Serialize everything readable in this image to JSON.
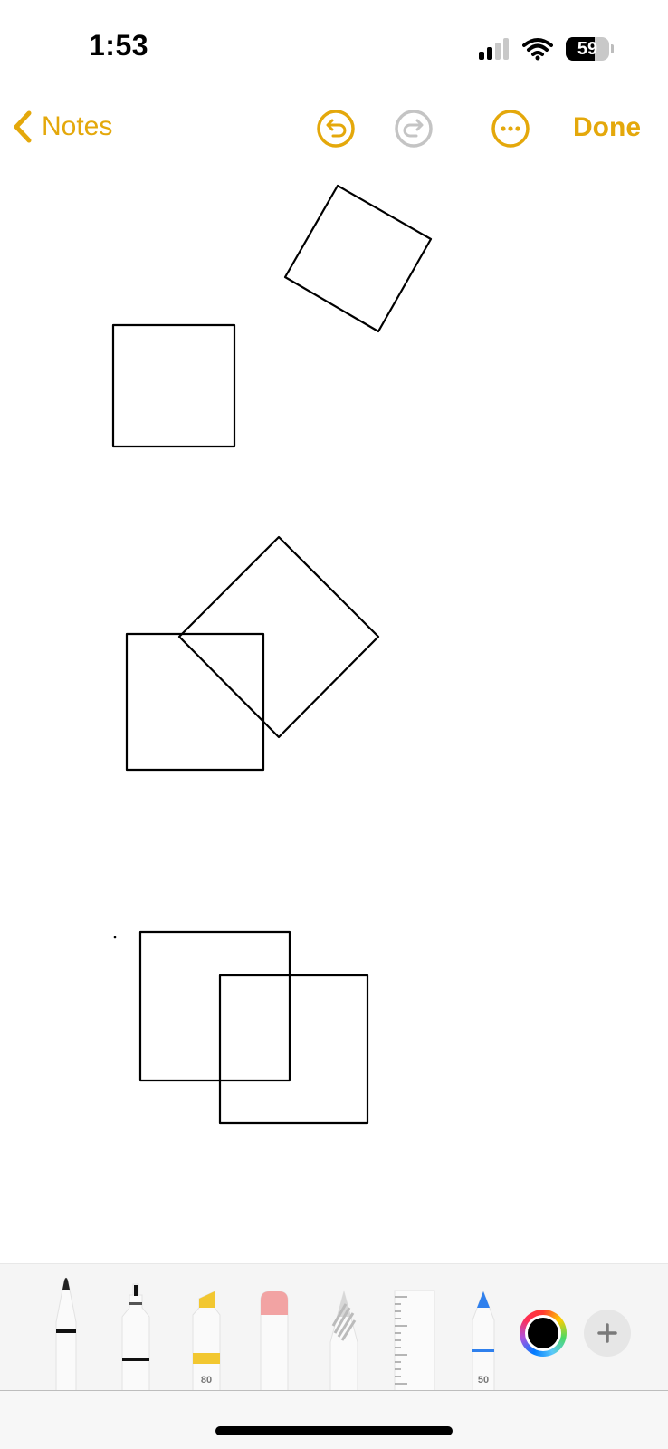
{
  "status_bar": {
    "time": "1:53",
    "battery_percent": "59"
  },
  "nav": {
    "back_label": "Notes",
    "done_label": "Done"
  },
  "icons": {
    "back": "chevron-left-icon",
    "undo": "undo-icon",
    "redo": "redo-icon",
    "more": "ellipsis-circle-icon",
    "add": "plus-icon"
  },
  "tools": {
    "marker_opacity": "80",
    "crayon_opacity": "50",
    "color_value": "#000000"
  },
  "colors": {
    "accent": "#E4A80B",
    "disabled": "#C4C4C4",
    "ink": "#000000",
    "highlighter": "#F2C730",
    "eraser": "#F2A3A3",
    "crayon": "#2F80ED"
  }
}
